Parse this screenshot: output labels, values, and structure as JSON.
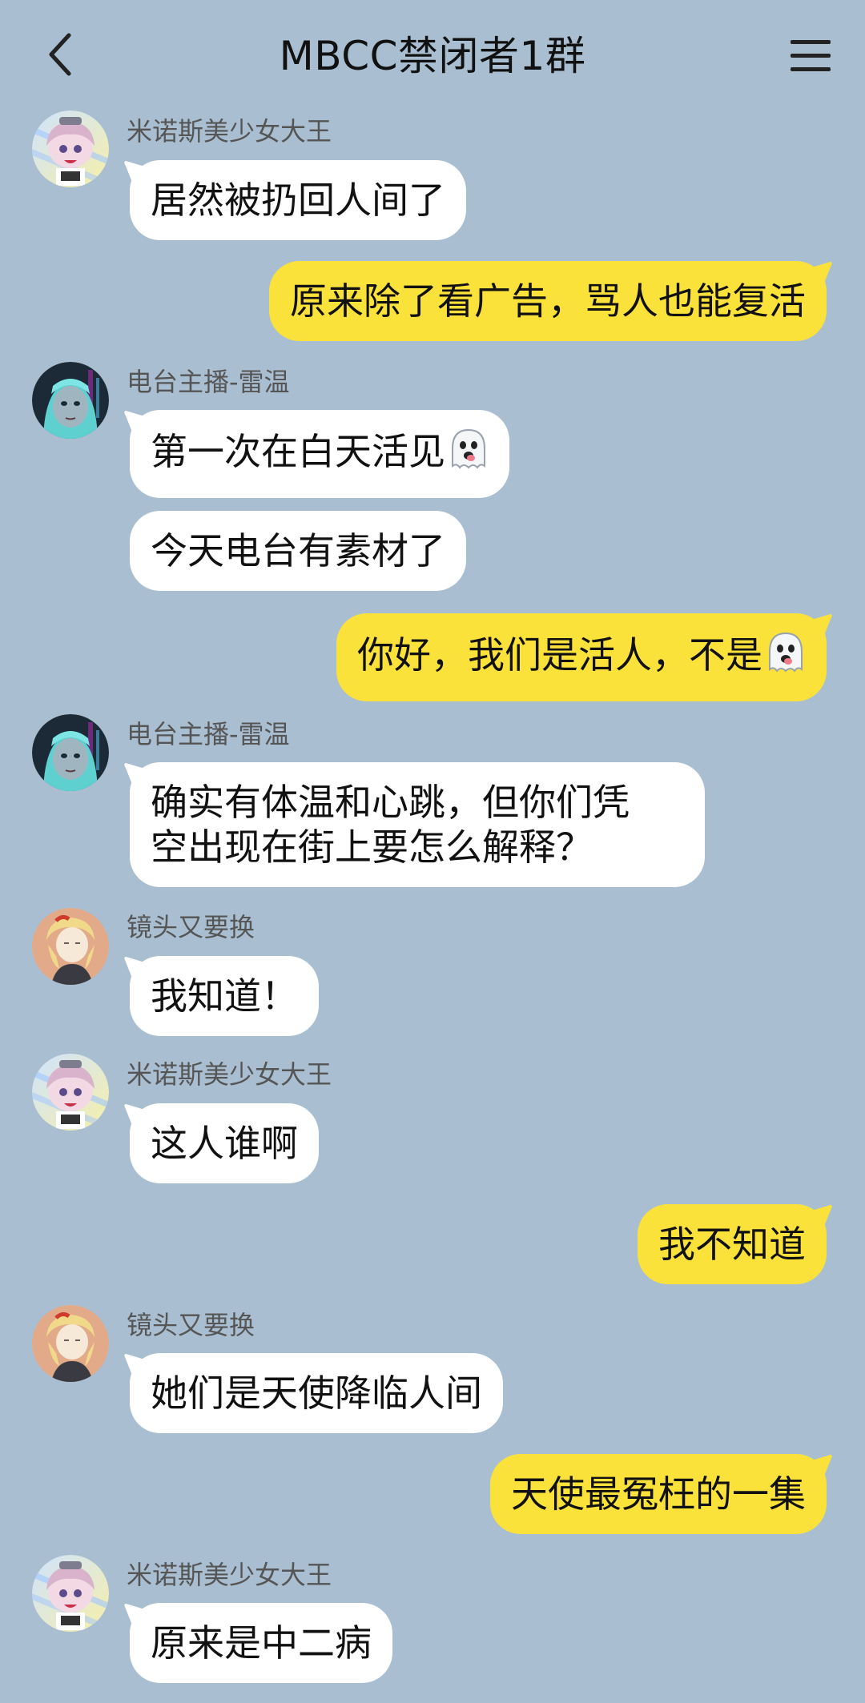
{
  "header": {
    "title": "MBCC禁闭者1群",
    "back_icon": "chevron-left-icon",
    "menu_icon": "hamburger-menu-icon"
  },
  "colors": {
    "background": "#a9bfd1",
    "incoming_bubble": "#ffffff",
    "outgoing_bubble": "#fbe23a"
  },
  "messages": [
    {
      "sender": "米诺斯美少女大王",
      "text": "居然被扔回人间了"
    },
    {
      "sender": "",
      "text": "原来除了看广告，骂人也能复活"
    },
    {
      "sender": "电台主播-雷温",
      "text": "第一次在白天活见"
    },
    {
      "sender": "",
      "text": "今天电台有素材了"
    },
    {
      "sender": "",
      "text": "你好，我们是活人，不是"
    },
    {
      "sender": "电台主播-雷温",
      "text": "确实有体温和心跳，但你们凭",
      "text2": "空出现在街上要怎么解释？"
    },
    {
      "sender": "镜头又要换",
      "text": "我知道！"
    },
    {
      "sender": "米诺斯美少女大王",
      "text": "这人谁啊"
    },
    {
      "sender": "",
      "text": "我不知道"
    },
    {
      "sender": "镜头又要换",
      "text": "她们是天使降临人间"
    },
    {
      "sender": "",
      "text": "天使最冤枉的一集"
    },
    {
      "sender": "米诺斯美少女大王",
      "text": "原来是中二病"
    }
  ]
}
